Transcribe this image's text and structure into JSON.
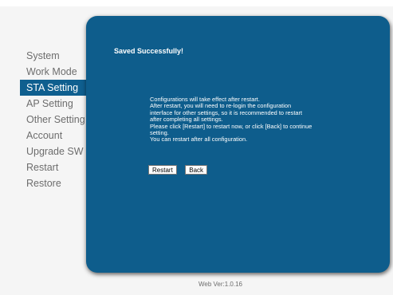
{
  "sidebar": {
    "items": [
      {
        "label": "System"
      },
      {
        "label": "Work Mode"
      },
      {
        "label": "STA Setting"
      },
      {
        "label": "AP Setting"
      },
      {
        "label": "Other Setting"
      },
      {
        "label": "Account"
      },
      {
        "label": "Upgrade SW"
      },
      {
        "label": "Restart"
      },
      {
        "label": "Restore"
      }
    ],
    "active_index": 2
  },
  "panel": {
    "title": "Saved Successfully!",
    "message_lines": [
      "Configurations will take effect after restart.",
      "After restart, you will need to re-login the configuration",
      "interface for other settings, so it is recommended to restart",
      "after completing all settings.",
      "Please click [Restart] to restart now, or click [Back] to continue",
      "setting.",
      "You can restart after all configuration."
    ],
    "restart_label": "Restart",
    "back_label": "Back"
  },
  "footer": {
    "version": "Web Ver:1.0.16"
  },
  "colors": {
    "panel_bg": "#0e5d8c",
    "active_nav_bg": "#0f5f8f",
    "nav_text": "#6d6d6d",
    "page_bg": "#f5f5f5"
  }
}
